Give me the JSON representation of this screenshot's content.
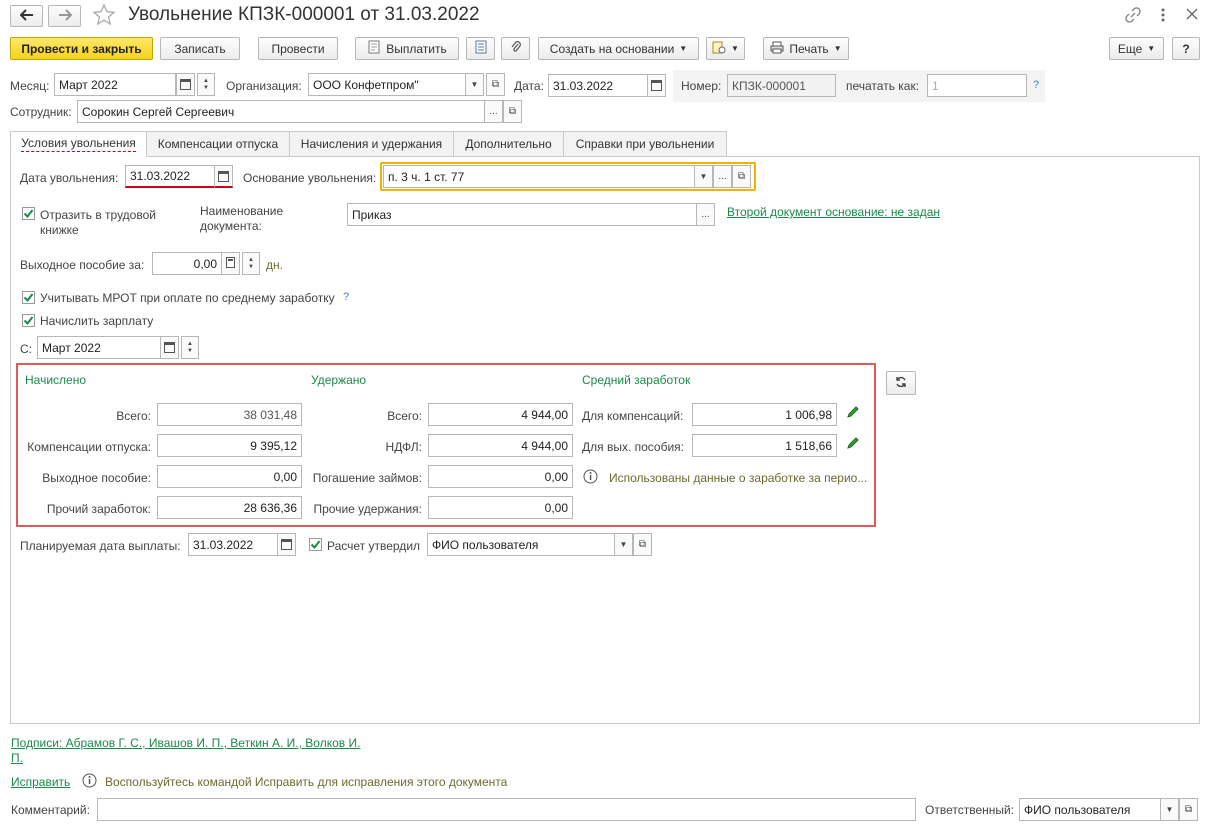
{
  "window": {
    "title": "Увольнение КПЗК-000001 от 31.03.2022"
  },
  "toolbar": {
    "post_close": "Провести и закрыть",
    "save": "Записать",
    "post": "Провести",
    "pay": "Выплатить",
    "create_based": "Создать на основании",
    "print": "Печать",
    "more": "Еще",
    "help": "?"
  },
  "header": {
    "month_label": "Месяц:",
    "month_value": "Март 2022",
    "org_label": "Организация:",
    "org_value": "ООО Конфетпром\"",
    "date_label": "Дата:",
    "date_value": "31.03.2022",
    "number_label": "Номер:",
    "number_value": "КПЗК-000001",
    "print_as_label": "печатать как:",
    "print_as_value": "1",
    "help_q": "?",
    "employee_label": "Сотрудник:",
    "employee_value": "Сорокин Сергей Сергеевич"
  },
  "tabs": [
    {
      "label": "Условия увольнения"
    },
    {
      "label": "Компенсации отпуска"
    },
    {
      "label": "Начисления и удержания"
    },
    {
      "label": "Дополнительно"
    },
    {
      "label": "Справки при увольнении"
    }
  ],
  "conditions": {
    "dismissal_date_label": "Дата увольнения:",
    "dismissal_date_value": "31.03.2022",
    "basis_label": "Основание увольнения:",
    "basis_value": "п. 3 ч. 1 ст. 77",
    "workbook_label_1": "Отразить в трудовой",
    "workbook_label_2": "книжке",
    "doc_name_label_1": "Наименование",
    "doc_name_label_2": "документа:",
    "doc_name_value": "Приказ",
    "second_doc_link": "Второй документ основание: не задан",
    "severance_label": "Выходное пособие за:",
    "severance_value": "0,00",
    "severance_unit": "дн.",
    "mrot_label": "Учитывать МРОТ при оплате по среднему заработку",
    "mrot_help": "?",
    "accrue_label": "Начислить зарплату",
    "from_label": "С:",
    "from_value": "Март 2022"
  },
  "summary": {
    "accrued_title": "Начислено",
    "withheld_title": "Удержано",
    "avg_title": "Средний заработок",
    "accrued": [
      {
        "label": "Всего:",
        "value": "38 031,48"
      },
      {
        "label": "Компенсации отпуска:",
        "value": "9 395,12"
      },
      {
        "label": "Выходное пособие:",
        "value": "0,00"
      },
      {
        "label": "Прочий заработок:",
        "value": "28 636,36"
      }
    ],
    "withheld": [
      {
        "label": "Всего:",
        "value": "4 944,00"
      },
      {
        "label": "НДФЛ:",
        "value": "4 944,00"
      },
      {
        "label": "Погашение займов:",
        "value": "0,00"
      },
      {
        "label": "Прочие удержания:",
        "value": "0,00"
      }
    ],
    "avg": [
      {
        "label": "Для компенсаций:",
        "value": "1 006,98"
      },
      {
        "label": "Для вых. пособия:",
        "value": "1 518,66"
      }
    ],
    "avg_info": "Использованы данные о заработке за перио..."
  },
  "payment": {
    "planned_date_label": "Планируемая дата выплаты:",
    "planned_date_value": "31.03.2022",
    "approved_label": "Расчет утвердил",
    "approved_value": "ФИО пользователя"
  },
  "footer": {
    "signatures_line1": "Подписи: Абрамов Г. С., Ивашов И. П., Веткин А. И., Волков И.",
    "signatures_line2": "П.",
    "fix_link": "Исправить",
    "fix_info": "Воспользуйтесь командой Исправить для исправления этого документа",
    "comment_label": "Комментарий:",
    "comment_value": "",
    "responsible_label": "Ответственный:",
    "responsible_value": "ФИО пользователя"
  },
  "colors": {
    "accent_green": "#1a8a4a",
    "primary_yellow": "#f5d31a",
    "highlight_red": "#e05a5a",
    "focus_orange": "#f0b400"
  }
}
